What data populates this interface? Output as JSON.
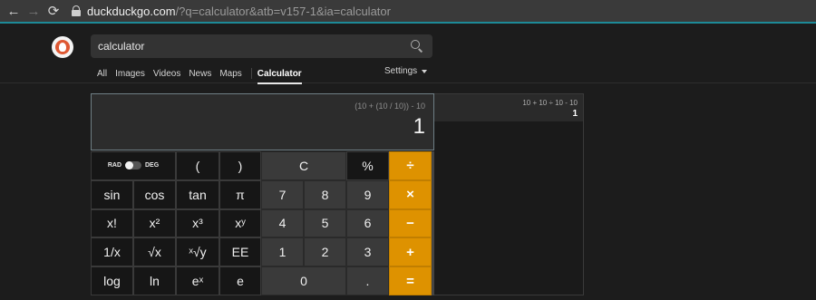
{
  "browser": {
    "url_host": "duckduckgo.com",
    "url_rest": "/?q=calculator&atb=v157-1&ia=calculator",
    "back_icon": "←",
    "forward_icon": "→",
    "reload_icon": "⟳"
  },
  "search": {
    "query": "calculator"
  },
  "tabs": [
    {
      "label": "All"
    },
    {
      "label": "Images"
    },
    {
      "label": "Videos"
    },
    {
      "label": "News"
    },
    {
      "label": "Maps"
    },
    {
      "label": "Calculator"
    }
  ],
  "settings_label": "Settings",
  "calculator": {
    "expression": "(10 + (10 / 10)) - 10",
    "result": "1",
    "toggle_left": "RAD",
    "toggle_right": "DEG",
    "keys": {
      "open_paren": "(",
      "close_paren": ")",
      "clear": "C",
      "percent": "%",
      "divide": "÷",
      "sin": "sin",
      "cos": "cos",
      "tan": "tan",
      "pi": "π",
      "seven": "7",
      "eight": "8",
      "nine": "9",
      "multiply": "×",
      "factorial": "x!",
      "square": "x²",
      "cube": "x³",
      "power": "xʸ",
      "four": "4",
      "five": "5",
      "six": "6",
      "minus": "−",
      "reciprocal": "1/x",
      "sqrt": "√x",
      "yroot": "ˣ√y",
      "ee": "EE",
      "one": "1",
      "two": "2",
      "three": "3",
      "plus": "+",
      "log": "log",
      "ln": "ln",
      "exp": "eˣ",
      "e": "e",
      "zero": "0",
      "decimal": ".",
      "equals": "="
    },
    "accent_color": "#de9200"
  },
  "history": {
    "expression": "10 + 10 ÷ 10 - 10",
    "result": "1"
  }
}
